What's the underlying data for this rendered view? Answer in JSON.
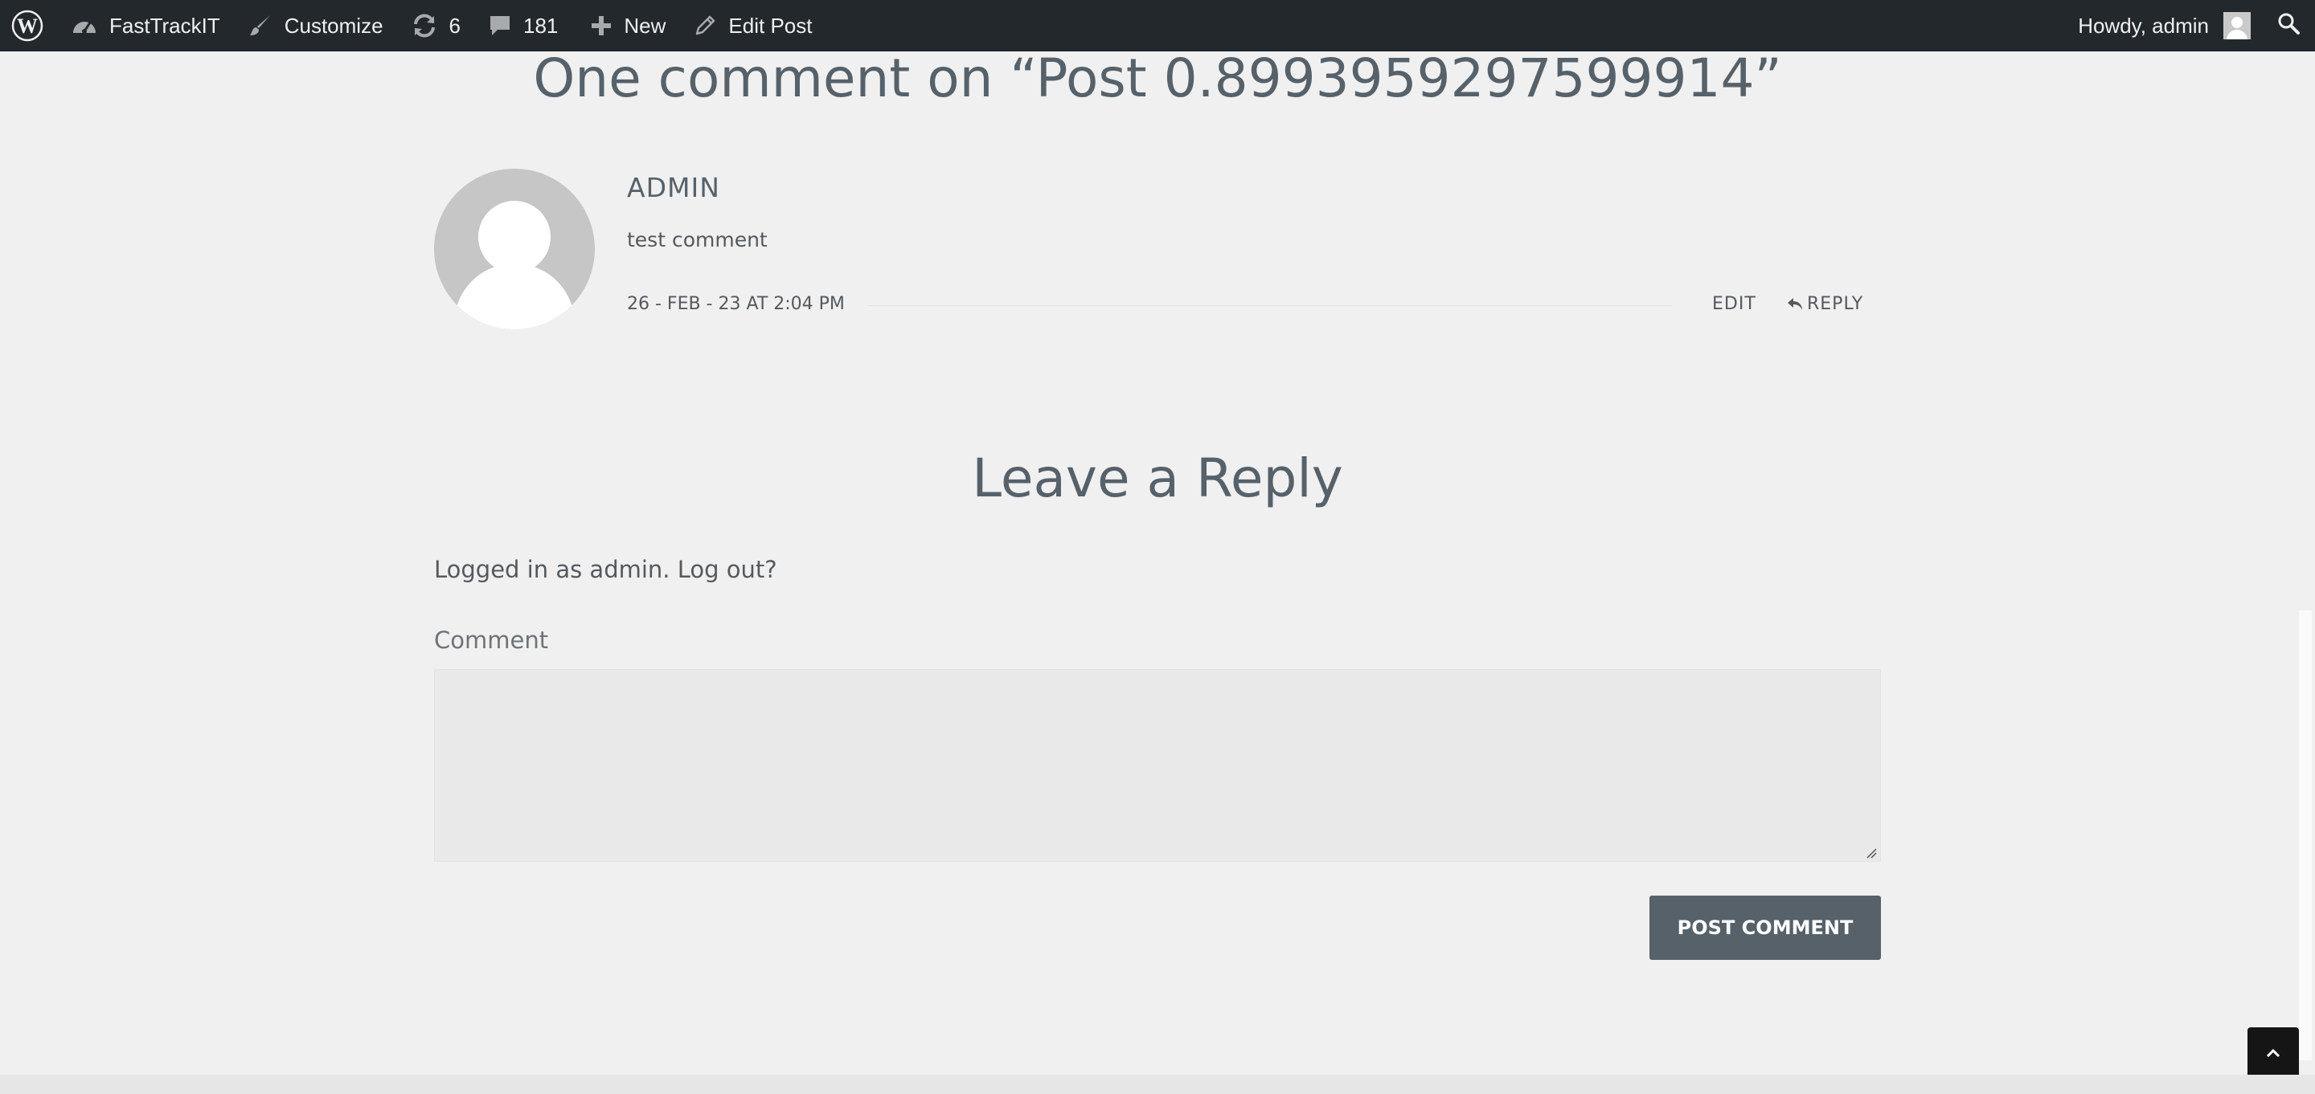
{
  "adminbar": {
    "site_name": "FastTrackIT",
    "customize": "Customize",
    "updates_count": "6",
    "comments_count": "181",
    "new_label": "New",
    "edit_post": "Edit Post",
    "howdy": "Howdy, admin"
  },
  "comments": {
    "title": "One comment on “Post 0.8993959297599914”",
    "items": [
      {
        "author": "ADMIN",
        "text": "test comment",
        "date": "26 - FEB - 23 AT 2:04 PM",
        "edit": "EDIT",
        "reply": "REPLY"
      }
    ]
  },
  "reply_form": {
    "title": "Leave a Reply",
    "logged_in": "Logged in as admin. Log out?",
    "comment_label": "Comment",
    "comment_value": "",
    "submit": "POST COMMENT"
  },
  "colors": {
    "adminbar_bg": "#23282d",
    "page_bg": "#f0f0f0",
    "button_bg": "#56616a",
    "text": "#54595f"
  }
}
